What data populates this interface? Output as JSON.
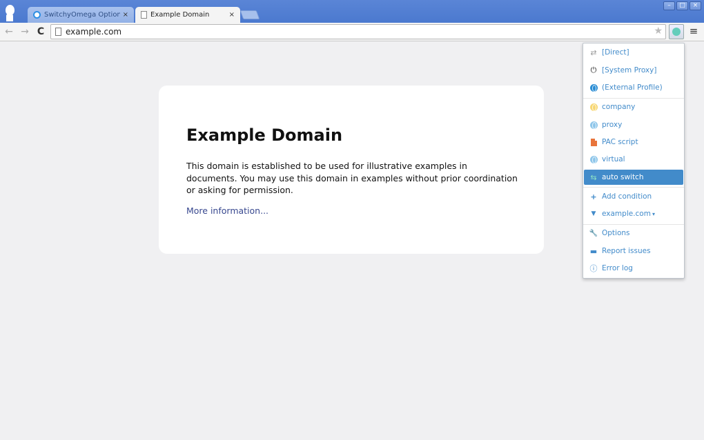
{
  "browser": {
    "tabs": [
      {
        "label": "SwitchyOmega Options",
        "active": false,
        "close": "×"
      },
      {
        "label": "Example Domain",
        "active": true,
        "close": "×"
      }
    ],
    "window_controls": {
      "minimize": "–",
      "maximize": "□",
      "close": "×"
    },
    "nav": {
      "back": "←",
      "forward": "→",
      "reload": "C"
    },
    "address": "example.com",
    "star": "★",
    "menu": "≡"
  },
  "page": {
    "title": "Example Domain",
    "description": "This domain is established to be used for illustrative examples in documents. You may use this domain in examples without prior coordination or asking for permission.",
    "link": "More information..."
  },
  "popup": {
    "items": [
      {
        "label": "[Direct]",
        "icon": "swap-icon",
        "glyph": "⇄"
      },
      {
        "label": "[System Proxy]",
        "icon": "power-icon",
        "glyph": "⏻"
      },
      {
        "label": "(External Profile)",
        "icon": "globe-icon",
        "color": "#2a8dd4"
      },
      {
        "label": "company",
        "icon": "globe-icon",
        "color": "#f7d774"
      },
      {
        "label": "proxy",
        "icon": "globe-icon",
        "color": "#8ec6ea"
      },
      {
        "label": "PAC script",
        "icon": "pac-file-icon",
        "color": "#e8743b"
      },
      {
        "label": "virtual",
        "icon": "globe-icon",
        "color": "#8ec6ea"
      },
      {
        "label": "auto switch",
        "icon": "auto-switch-icon",
        "glyph": "⇆",
        "selected": true
      },
      {
        "label": "Add condition",
        "icon": "plus-icon",
        "glyph": "+"
      },
      {
        "label": "example.com",
        "icon": "filter-icon",
        "glyph": "▼",
        "caret": "▾"
      },
      {
        "label": "Options",
        "icon": "wrench-icon",
        "glyph": "🔧"
      },
      {
        "label": "Report issues",
        "icon": "comment-icon",
        "glyph": "▬"
      },
      {
        "label": "Error log",
        "icon": "info-icon",
        "glyph": "ⓘ"
      }
    ]
  },
  "colors": {
    "accent": "#428bca",
    "link": "#38488f",
    "tabstrip": "#4b79cf"
  }
}
